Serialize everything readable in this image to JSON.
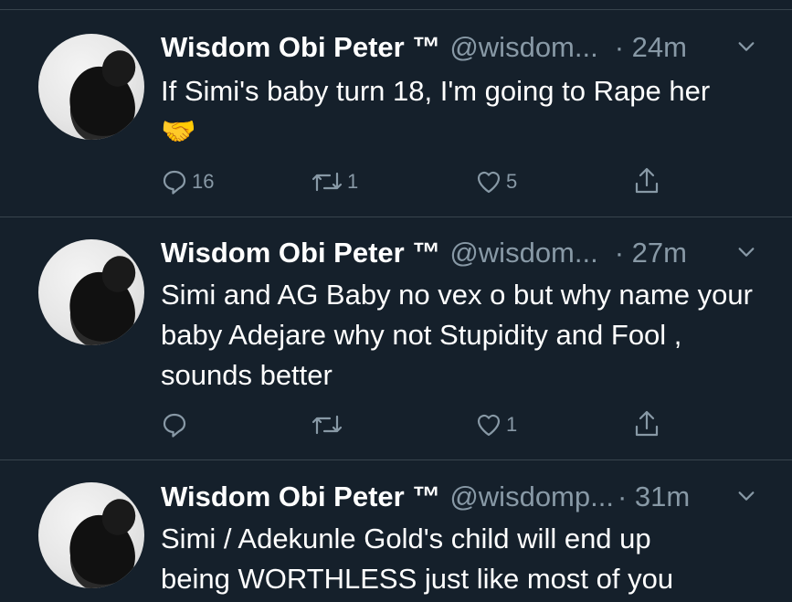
{
  "tweets": [
    {
      "name": "Wisdom Obi Peter ™",
      "handle": "@wisdom...",
      "time": "· 24m",
      "text": "If Simi's baby turn 18, I'm going to Rape her 🤝",
      "replies": "16",
      "retweets": "1",
      "likes": "5"
    },
    {
      "name": "Wisdom Obi Peter ™",
      "handle": "@wisdom...",
      "time": "· 27m",
      "text": "Simi and AG Baby no vex o but why name your baby Adejare why not Stupidity and Fool  , sounds better",
      "replies": "",
      "retweets": "",
      "likes": "1"
    },
    {
      "name": "Wisdom Obi Peter ™",
      "handle": "@wisdomp...",
      "time": "· 31m",
      "text": "Simi / Adekunle Gold's child will end up being WORTHLESS just like most of you",
      "replies": "",
      "retweets": "",
      "likes": ""
    }
  ],
  "icons": {
    "reply": "reply-icon",
    "retweet": "retweet-icon",
    "like": "like-icon",
    "share": "share-icon",
    "menu": "chevron-down-icon"
  },
  "colors": {
    "background": "#15202b",
    "secondary_text": "#8899a6",
    "divider": "#38444d"
  }
}
